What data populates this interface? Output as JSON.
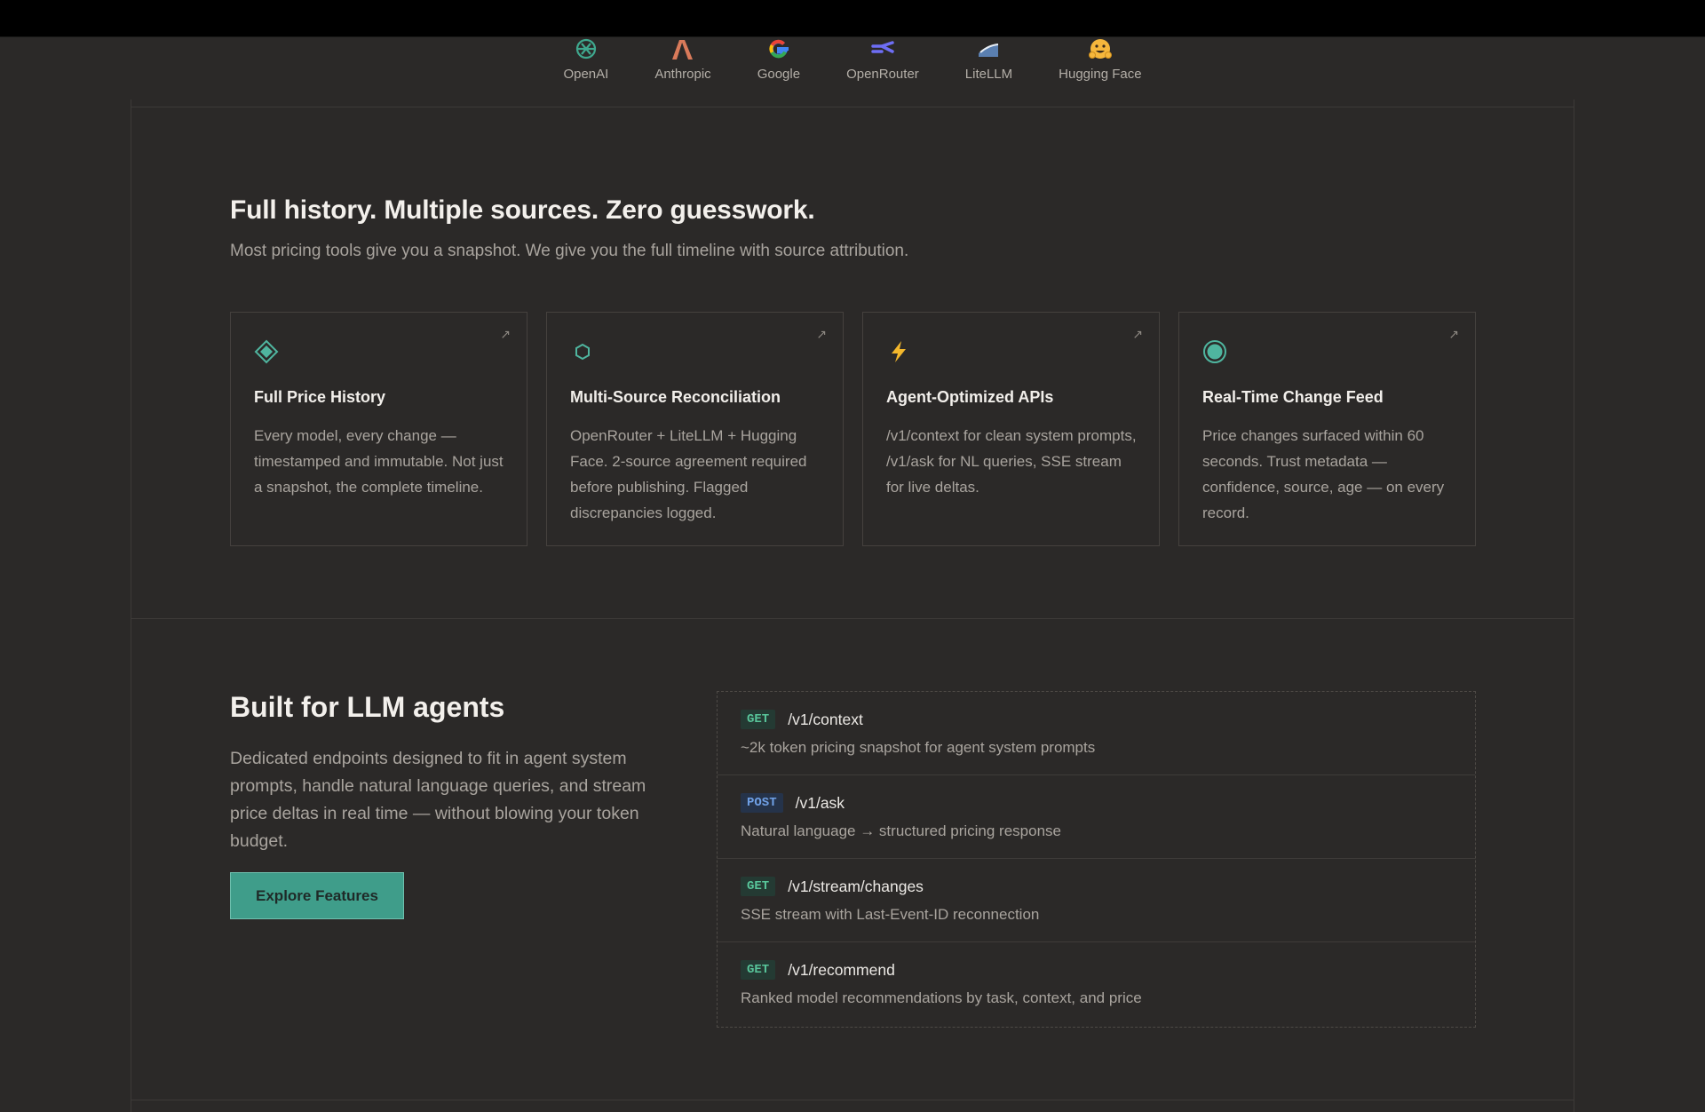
{
  "providers": [
    {
      "label": "OpenAI",
      "icon": "openai-icon"
    },
    {
      "label": "Anthropic",
      "icon": "anthropic-icon"
    },
    {
      "label": "Google",
      "icon": "google-icon"
    },
    {
      "label": "OpenRouter",
      "icon": "openrouter-icon"
    },
    {
      "label": "LiteLLM",
      "icon": "litellm-icon"
    },
    {
      "label": "Hugging Face",
      "icon": "hugging-face-icon"
    }
  ],
  "features": {
    "title": "Full history. Multiple sources. Zero guesswork.",
    "subtitle": "Most pricing tools give you a snapshot. We give you the full timeline with source attribution.",
    "cards": [
      {
        "icon": "diamond-icon",
        "title": "Full Price History",
        "description": "Every model, every change — timestamped and immutable. Not just a snapshot, the complete timeline."
      },
      {
        "icon": "hexagon-icon",
        "title": "Multi-Source Reconciliation",
        "description": "OpenRouter + LiteLLM + Hugging Face. 2-source agreement required before publishing. Flagged discrepancies logged."
      },
      {
        "icon": "lightning-icon",
        "title": "Agent-Optimized APIs",
        "description": "/v1/context for clean system prompts, /v1/ask for NL queries, SSE stream for live deltas."
      },
      {
        "icon": "target-icon",
        "title": "Real-Time Change Feed",
        "description": "Price changes surfaced within 60 seconds. Trust metadata — confidence, source, age — on every record."
      }
    ],
    "card_arrow": "↗"
  },
  "agents": {
    "title": "Built for LLM agents",
    "description": "Dedicated endpoints designed to fit in agent system prompts, handle natural language queries, and stream price deltas in real time — without blowing your token budget.",
    "cta_label": "Explore Features",
    "endpoints": [
      {
        "method": "GET",
        "path": "/v1/context",
        "description": "~2k token pricing snapshot for agent system prompts"
      },
      {
        "method": "POST",
        "path": "/v1/ask",
        "description": "Natural language → structured pricing response"
      },
      {
        "method": "GET",
        "path": "/v1/stream/changes",
        "description": "SSE stream with Last-Event-ID reconnection"
      },
      {
        "method": "GET",
        "path": "/v1/recommend",
        "description": "Ranked model recommendations by task, context, and price"
      }
    ]
  },
  "colors": {
    "background": "#2b2928",
    "accent": "#3f9d8a",
    "get_badge": "#58c59a",
    "post_badge": "#6fa0e6"
  }
}
